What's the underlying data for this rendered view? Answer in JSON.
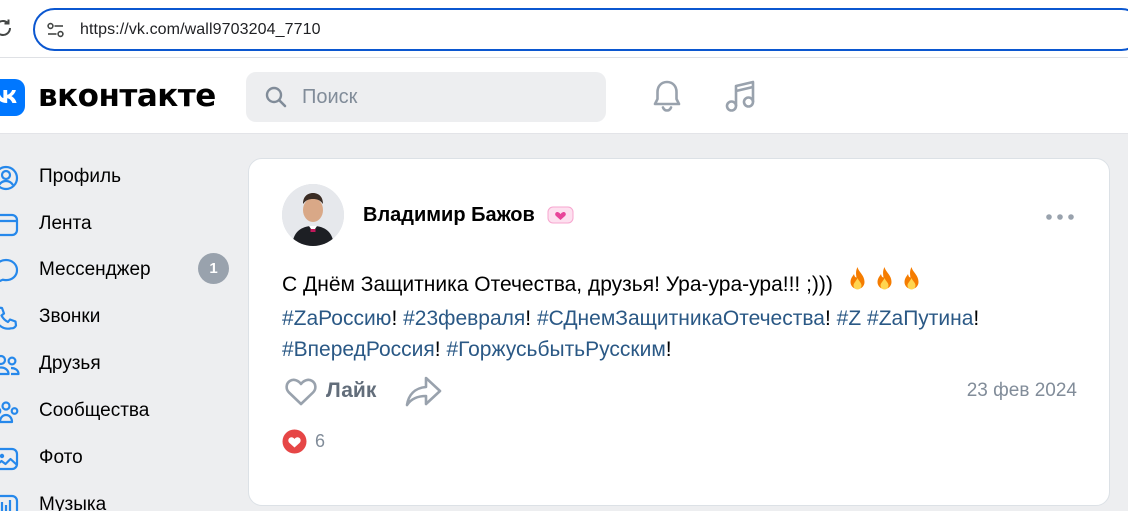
{
  "browser": {
    "url": "https://vk.com/wall9703204_7710"
  },
  "header": {
    "logo_text": "вконтакте",
    "search_placeholder": "Поиск",
    "brand_color": "#0077ff"
  },
  "sidebar": {
    "items": [
      {
        "label": "Профиль",
        "icon": "profile-icon"
      },
      {
        "label": "Лента",
        "icon": "feed-icon"
      },
      {
        "label": "Мессенджер",
        "icon": "messenger-icon",
        "badge": "1"
      },
      {
        "label": "Звонки",
        "icon": "phone-icon"
      },
      {
        "label": "Друзья",
        "icon": "friends-icon"
      },
      {
        "label": "Сообщества",
        "icon": "communities-icon"
      },
      {
        "label": "Фото",
        "icon": "photo-icon"
      },
      {
        "label": "Музыка",
        "icon": "music-icon"
      }
    ]
  },
  "post": {
    "author": "Владимир Бажов",
    "text_line1": "С Днём Защитника Отечества, друзья! Ура-ура-ура!!! ;)))",
    "hashtags": {
      "h1": "#ZaРоссию",
      "h2": "#23февраля",
      "h3": "#СДнемЗащитникаОтечества",
      "h4": "#Z",
      "h5": "#ZaПутина",
      "h6": "#ВпередРоссия",
      "h7": "#ГоржусьбытьРусским"
    },
    "exclaim": "!",
    "like_label": "Лайк",
    "date": "23 фев 2024",
    "reactions_count": "6",
    "link_color": "#2a5885",
    "reaction_color": "#e64646"
  }
}
